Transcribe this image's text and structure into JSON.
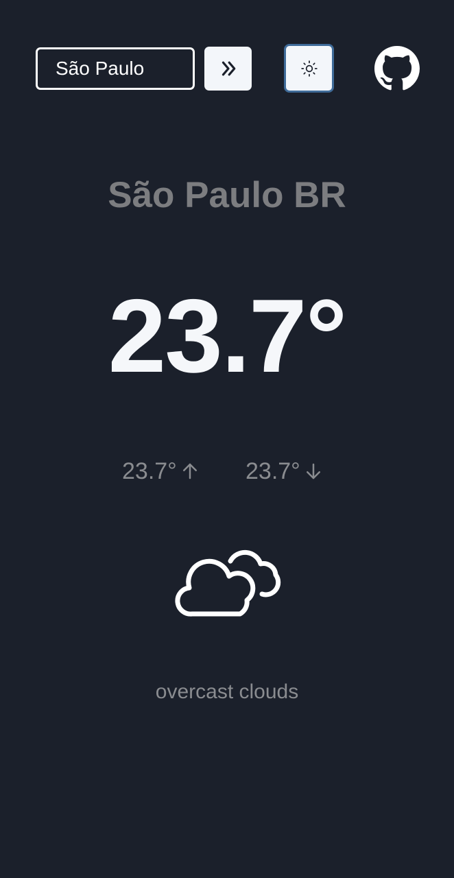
{
  "search": {
    "value": "São Paulo",
    "button_icon": "chevrons-right-icon"
  },
  "theme_toggle": {
    "icon": "sun-icon"
  },
  "github": {
    "icon": "github-icon"
  },
  "weather": {
    "city": "São Paulo BR",
    "temperature": "23.7°",
    "temp_max": "23.7°",
    "temp_min": "23.7°",
    "condition_icon": "clouds-icon",
    "description": "overcast clouds"
  },
  "colors": {
    "background": "#1b202b",
    "text_primary": "#f5f7fa",
    "text_muted": "#8a8c90",
    "accent_border": "#3f6b99"
  }
}
